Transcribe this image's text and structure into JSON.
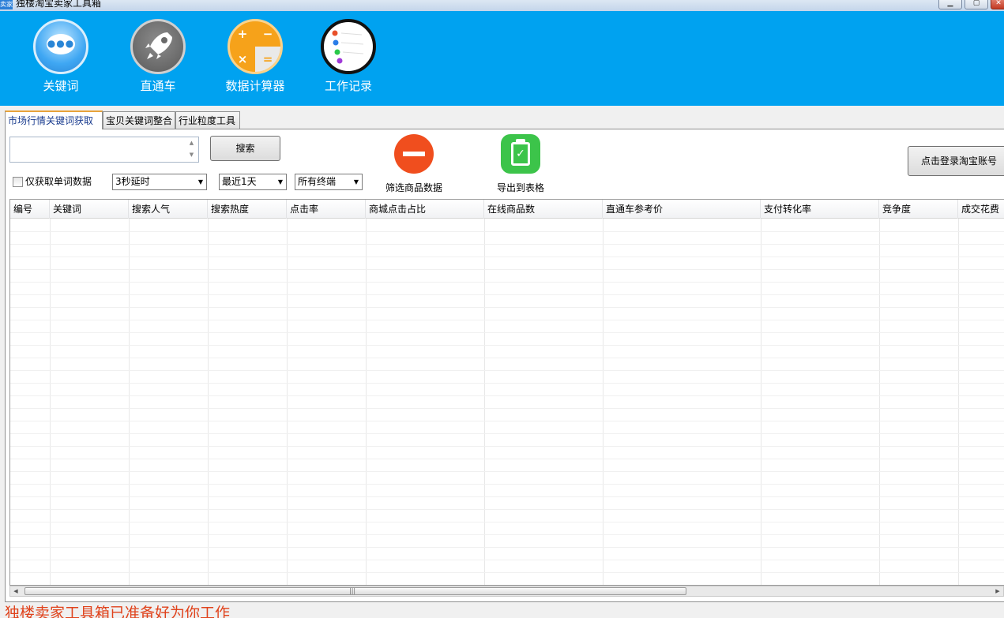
{
  "window": {
    "title": "独楼淘宝卖家工具箱",
    "app_icon_text": "卖家"
  },
  "header": {
    "items": [
      {
        "label": "关键词",
        "icon": "chat-bubble-icon"
      },
      {
        "label": "直通车",
        "icon": "rocket-icon"
      },
      {
        "label": "数据计算器",
        "icon": "calculator-icon"
      },
      {
        "label": "工作记录",
        "icon": "notes-icon"
      }
    ],
    "calculator_symbols": [
      "+",
      "−",
      "×",
      "="
    ],
    "background_color": "#00a2f0"
  },
  "tabs": [
    {
      "label": "市场行情关键词获取",
      "active": true
    },
    {
      "label": "宝贝关键词整合",
      "active": false
    },
    {
      "label": "行业粒度工具",
      "active": false
    }
  ],
  "controls": {
    "keyword_input_value": "",
    "search_label": "搜索",
    "single_word_label": "仅获取单词数据",
    "single_word_checked": false,
    "delay_select": "3秒延时",
    "days_select": "最近1天",
    "terminal_select": "所有终端",
    "filter_label": "筛选商品数据",
    "export_label": "导出到表格",
    "login_label": "点击登录淘宝账号"
  },
  "table": {
    "columns": [
      "编号",
      "关键词",
      "搜索人气",
      "搜索热度",
      "点击率",
      "商城点击占比",
      "在线商品数",
      "直通车参考价",
      "支付转化率",
      "竞争度",
      "成交花费"
    ],
    "rows": []
  },
  "status": {
    "message": "独楼卖家工具箱已准备好为你工作",
    "color": "#e0421b"
  }
}
